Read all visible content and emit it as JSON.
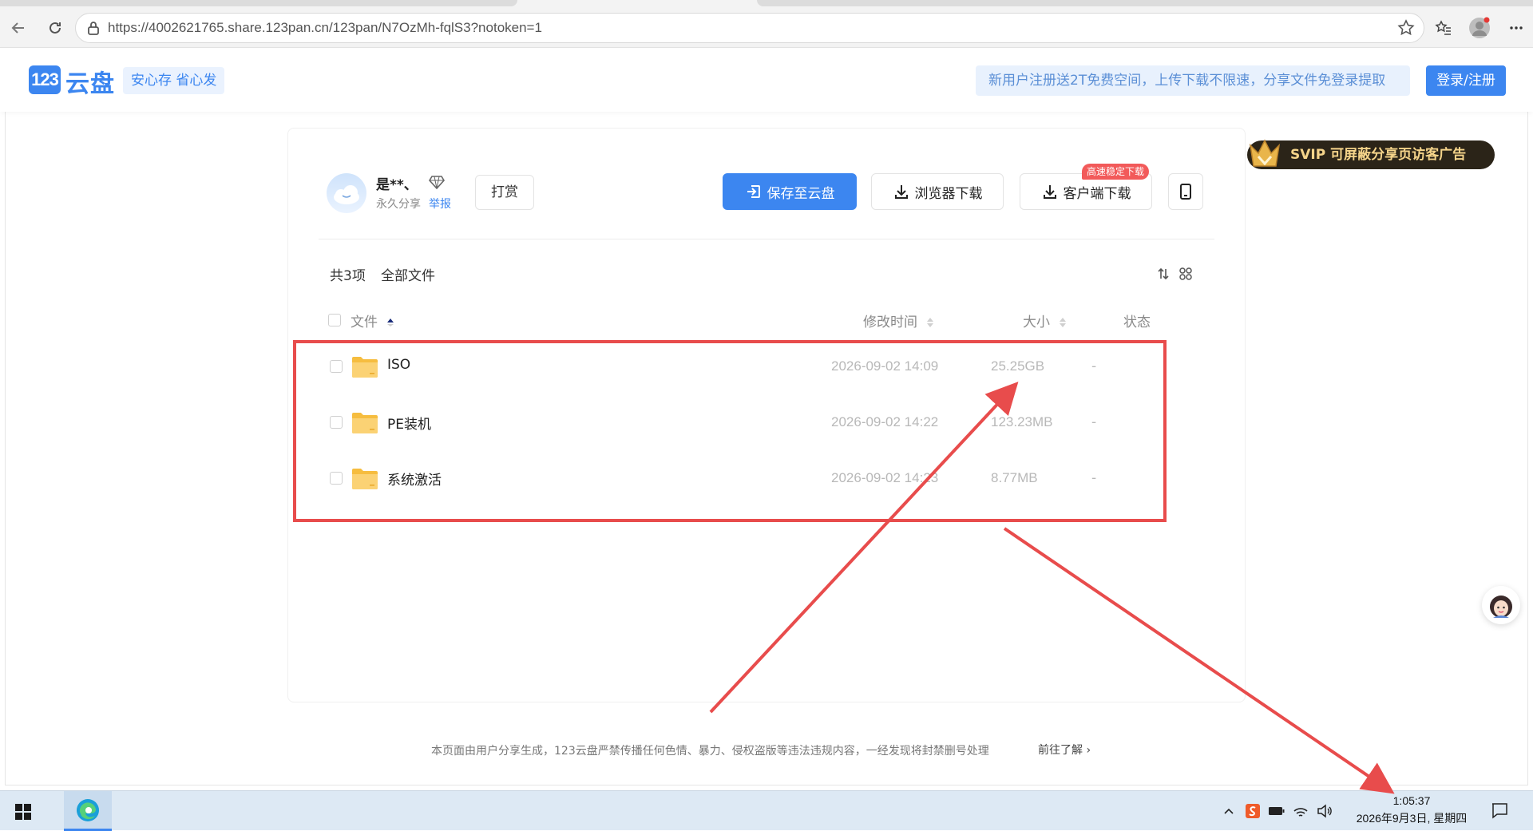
{
  "browser": {
    "url": "https://4002621765.share.123pan.cn/123pan/N7OzMh-fqlS3?notoken=1"
  },
  "header": {
    "logo_badge": "123",
    "logo_text": "云盘",
    "slogan": "安心存 省心发",
    "promo": "新用户注册送2T免费空间，上传下载不限速，分享文件免登录提取",
    "login_label": "登录/注册"
  },
  "sharer": {
    "name": "是**、",
    "share_type": "永久分享",
    "report": "举报",
    "tip_label": "打赏"
  },
  "actions": {
    "save": "保存至云盘",
    "browser_download": "浏览器下载",
    "client_download": "客户端下载",
    "client_badge": "高速稳定下载"
  },
  "toolbar": {
    "count": "共3项",
    "breadcrumb": "全部文件"
  },
  "table": {
    "headers": {
      "name": "文件",
      "mtime": "修改时间",
      "size": "大小",
      "status": "状态"
    },
    "rows": [
      {
        "name": "ISO",
        "mtime": "2026-09-02 14:09",
        "size": "25.25GB",
        "status": "-"
      },
      {
        "name": "PE装机",
        "mtime": "2026-09-02 14:22",
        "size": "123.23MB",
        "status": "-"
      },
      {
        "name": "系统激活",
        "mtime": "2026-09-02 14:23",
        "size": "8.77MB",
        "status": "-"
      }
    ]
  },
  "svip": {
    "label": "SVIP 可屏蔽分享页访客广告"
  },
  "footer": {
    "notice": "本页面由用户分享生成，123云盘严禁传播任何色情、暴力、侵权盗版等违法违规内容，一经发现将封禁删号处理",
    "link": "前往了解 ›"
  },
  "taskbar": {
    "time": "1:05:37",
    "date": "2026年9月3日, 星期四"
  },
  "colors": {
    "accent": "#3c86f0",
    "annotation": "#e84c4c",
    "folder": "#f9c94e"
  }
}
